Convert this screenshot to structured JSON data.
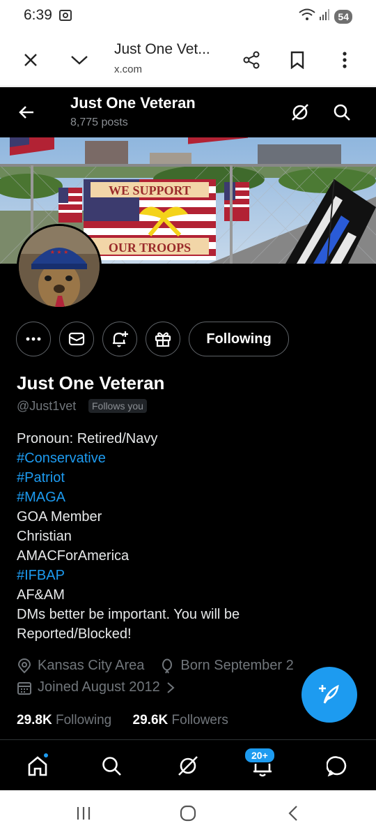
{
  "status_bar": {
    "time": "6:39",
    "battery": "54"
  },
  "browser": {
    "title": "Just One Vet...",
    "url": "x.com"
  },
  "header": {
    "name": "Just One Veteran",
    "posts": "8,775 posts"
  },
  "profile": {
    "name": "Just One Veteran",
    "handle": "@Just1vet",
    "follows_you": "Follows you",
    "follow_button": "Following",
    "bio": [
      {
        "text": "Pronoun: Retired/Navy",
        "hashtag": false
      },
      {
        "text": "#Conservative",
        "hashtag": true
      },
      {
        "text": "#Patriot",
        "hashtag": true
      },
      {
        "text": "#MAGA",
        "hashtag": true
      },
      {
        "text": "GOA Member",
        "hashtag": false
      },
      {
        "text": "Christian",
        "hashtag": false
      },
      {
        "text": "AMACForAmerica",
        "hashtag": false
      },
      {
        "text": "#IFBAP",
        "hashtag": true
      },
      {
        "text": "AF&AM",
        "hashtag": false
      },
      {
        "text": "DMs better be important. You will be",
        "hashtag": false
      },
      {
        "text": "Reported/Blocked!",
        "hashtag": false
      }
    ],
    "location": "Kansas City Area",
    "birthday": "Born September 2",
    "joined": "Joined August 2012",
    "following_count": "29.8K",
    "following_label": "Following",
    "followers_count": "29.6K",
    "followers_label": "Followers"
  },
  "banner": {
    "flag_top_text": "WE SUPPORT",
    "flag_bottom_text": "OUR TROOPS"
  },
  "bottom_nav": {
    "notifications_badge": "20+"
  },
  "colors": {
    "accent": "#1d9bf0",
    "background": "#000000",
    "muted": "#71767b"
  }
}
